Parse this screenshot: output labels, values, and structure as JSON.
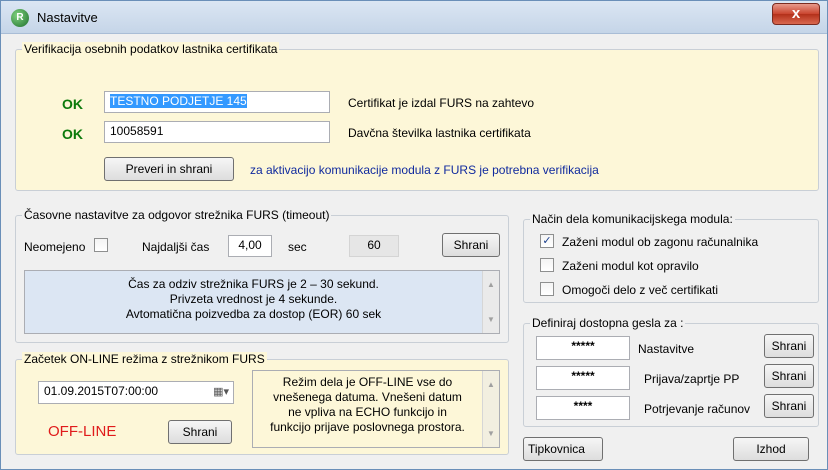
{
  "window": {
    "title": "Nastavitve",
    "close_glyph": "x",
    "app_icon_glyph": "R"
  },
  "verification": {
    "title": "Verifikacija osebnih podatkov lastnika certifikata",
    "rows": [
      {
        "status": "OK",
        "value": "TESTNO PODJETJE 145",
        "label": "Certifikat je izdal FURS na zahtevo"
      },
      {
        "status": "OK",
        "value": "10058591",
        "label": "Davčna številka lastnika certifikata"
      }
    ],
    "verify_button": "Preveri in shrani",
    "note": "za aktivacijo komunikacije modula z FURS je potrebna verifikacija"
  },
  "timeout": {
    "title": "Časovne nastavitve za odgovor strežnika FURS (timeout)",
    "unlimited_label": "Neomejeno",
    "unlimited_checked": false,
    "longest_label": "Najdaljši čas",
    "longest_value": "4,00",
    "unit": "sec",
    "eor_value": "60",
    "save_button": "Shrani",
    "info_lines": [
      "Čas za odziv strežnika FURS je 2 – 30 sekund.",
      "Privzeta vrednost je 4 sekunde.",
      "Avtomatična poizvedba za dostop  (EOR) 60 sek"
    ]
  },
  "online": {
    "title": "Začetek ON-LINE režima z strežnikom FURS",
    "datetime": "01.09.2015T07:00:00",
    "status": "OFF-LINE",
    "status_color": "#e01b1b",
    "save_button": "Shrani",
    "info_lines": [
      "Režim dela je OFF-LINE vse do",
      "vnešenega datuma. Vnešeni datum",
      "ne vpliva na ECHO funkcijo in",
      "funkcijo prijave poslovnega prostora."
    ]
  },
  "mode": {
    "title": "Način dela komunikacijskega modula:",
    "options": [
      {
        "label": "Zaženi modul ob zagonu računalnika",
        "checked": true
      },
      {
        "label": "Zaženi modul kot opravilo",
        "checked": false
      },
      {
        "label": "Omogoči delo z več certifikati",
        "checked": false
      }
    ]
  },
  "passwords": {
    "title": "Definiraj dostopna gesla za :",
    "rows": [
      {
        "mask": "*****",
        "label": "Nastavitve",
        "button": "Shrani"
      },
      {
        "mask": "*****",
        "label": "Prijava/zaprtje PP",
        "button": "Shrani"
      },
      {
        "mask": "****",
        "label": "Potrjevanje računov",
        "button": "Shrani"
      }
    ]
  },
  "footer": {
    "keyboard_button": "Tipkovnica",
    "exit_button": "Izhod"
  },
  "colors": {
    "ok": "#0b7a0b",
    "panel_yellow": "#fdf7d8",
    "info_blue": "#dce6f3",
    "link_blue": "#102a9e"
  }
}
